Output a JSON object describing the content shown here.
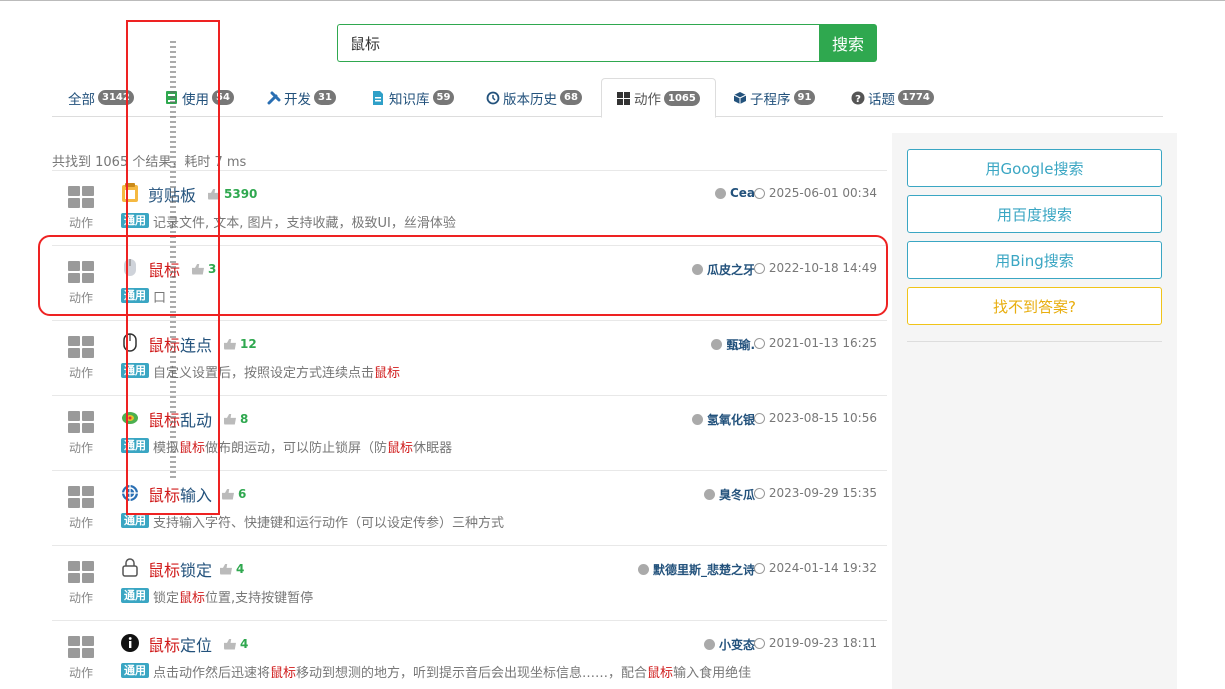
{
  "search": {
    "value": "鼠标",
    "button": "搜索"
  },
  "tabs": [
    {
      "label": "全部",
      "count": "3142",
      "icon": ""
    },
    {
      "label": "使用",
      "count": "54",
      "icon": "book-icon"
    },
    {
      "label": "开发",
      "count": "31",
      "icon": "wrench-icon"
    },
    {
      "label": "知识库",
      "count": "59",
      "icon": "file-icon"
    },
    {
      "label": "版本历史",
      "count": "68",
      "icon": "history-icon"
    },
    {
      "label": "动作",
      "count": "1065",
      "icon": "grid-icon",
      "active": true
    },
    {
      "label": "子程序",
      "count": "91",
      "icon": "cube-icon"
    },
    {
      "label": "话题",
      "count": "1774",
      "icon": "question-icon"
    }
  ],
  "summary": "共找到 1065 个结果，耗时 7 ms",
  "results": [
    {
      "kind": "动作",
      "icon": "clipboard-icon",
      "title_hl": "",
      "title_rest": "剪贴板",
      "likes": "5390",
      "author": "Cea",
      "date": "2025-06-01 00:34",
      "tag": "通用",
      "desc": "记录文件, 文本, 图片，支持收藏，极致UI，丝滑体验"
    },
    {
      "kind": "动作",
      "icon": "mouse-icon",
      "title_hl": "鼠标",
      "title_rest": "",
      "likes": "3",
      "author": "瓜皮之牙",
      "date": "2022-10-18 14:49",
      "tag": "通用",
      "desc": "口"
    },
    {
      "kind": "动作",
      "icon": "mouse-outline-icon",
      "title_hl": "鼠标",
      "title_rest": "连点",
      "likes": "12",
      "author": "甄瑜.",
      "date": "2021-01-13 16:25",
      "tag": "通用",
      "desc_pre": "自定义设置后，按照设定方式连续点击",
      "desc_hl": "鼠标"
    },
    {
      "kind": "动作",
      "icon": "swirl-icon",
      "title_hl": "鼠标",
      "title_rest": "乱动",
      "likes": "8",
      "author": "氢氧化银",
      "date": "2023-08-15 10:56",
      "tag": "通用",
      "desc_pre": "模拟",
      "desc_hl": "鼠标",
      "desc_mid": "做布朗运动，可以防止锁屏（防",
      "desc_hl2": "鼠标",
      "desc_post": "休眠器"
    },
    {
      "kind": "动作",
      "icon": "crosshair-icon",
      "title_hl": "鼠标",
      "title_rest": "输入",
      "likes": "6",
      "author": "臭冬瓜",
      "date": "2023-09-29 15:35",
      "tag": "通用",
      "desc": "支持输入字符、快捷键和运行动作（可以设定传参）三种方式"
    },
    {
      "kind": "动作",
      "icon": "lock-icon",
      "title_hl": "鼠标",
      "title_rest": "锁定",
      "likes": "4",
      "author": "默德里斯_悲楚之诗",
      "date": "2024-01-14 19:32",
      "tag": "通用",
      "desc_pre": "锁定",
      "desc_hl": "鼠标",
      "desc_post": "位置,支持按键暂停"
    },
    {
      "kind": "动作",
      "icon": "info-icon",
      "title_hl": "鼠标",
      "title_rest": "定位",
      "likes": "4",
      "author": "小变态",
      "date": "2019-09-23 18:11",
      "tag": "通用",
      "desc_pre": "点击动作然后迅速将",
      "desc_hl": "鼠标",
      "desc_mid": "移动到想测的地方，听到提示音后会出现坐标信息……，配合",
      "desc_hl2": "鼠标",
      "desc_post": "输入食用绝佳"
    }
  ],
  "sidebar": {
    "google": "用Google搜索",
    "baidu": "用百度搜索",
    "bing": "用Bing搜索",
    "no_answer": "找不到答案?"
  }
}
